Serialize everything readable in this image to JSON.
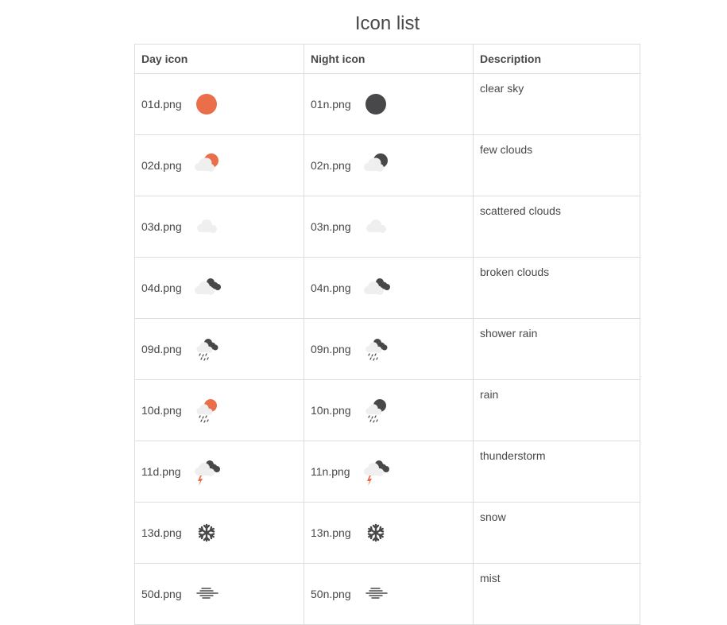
{
  "page": {
    "title": "Icon list"
  },
  "table": {
    "headers": {
      "day": "Day icon",
      "night": "Night icon",
      "description": "Description"
    },
    "rows": [
      {
        "day_file": "01d.png",
        "night_file": "01n.png",
        "description": "clear sky",
        "icon": "clear-sky"
      },
      {
        "day_file": "02d.png",
        "night_file": "02n.png",
        "description": "few clouds",
        "icon": "few-clouds"
      },
      {
        "day_file": "03d.png",
        "night_file": "03n.png",
        "description": "scattered clouds",
        "icon": "scattered-clouds"
      },
      {
        "day_file": "04d.png",
        "night_file": "04n.png",
        "description": "broken clouds",
        "icon": "broken-clouds"
      },
      {
        "day_file": "09d.png",
        "night_file": "09n.png",
        "description": "shower rain",
        "icon": "shower-rain"
      },
      {
        "day_file": "10d.png",
        "night_file": "10n.png",
        "description": "rain",
        "icon": "rain"
      },
      {
        "day_file": "11d.png",
        "night_file": "11n.png",
        "description": "thunderstorm",
        "icon": "thunderstorm"
      },
      {
        "day_file": "13d.png",
        "night_file": "13n.png",
        "description": "snow",
        "icon": "snow"
      },
      {
        "day_file": "50d.png",
        "night_file": "50n.png",
        "description": "mist",
        "icon": "mist"
      }
    ]
  },
  "colors": {
    "sun": "#eb6e4b",
    "moon": "#48484a",
    "dark_cloud": "#48484a",
    "light_cloud": "#efefef",
    "rain_drops": "#48484a",
    "lightning": "#eb6e4b",
    "text": "#48484a",
    "border": "#dddddd"
  }
}
